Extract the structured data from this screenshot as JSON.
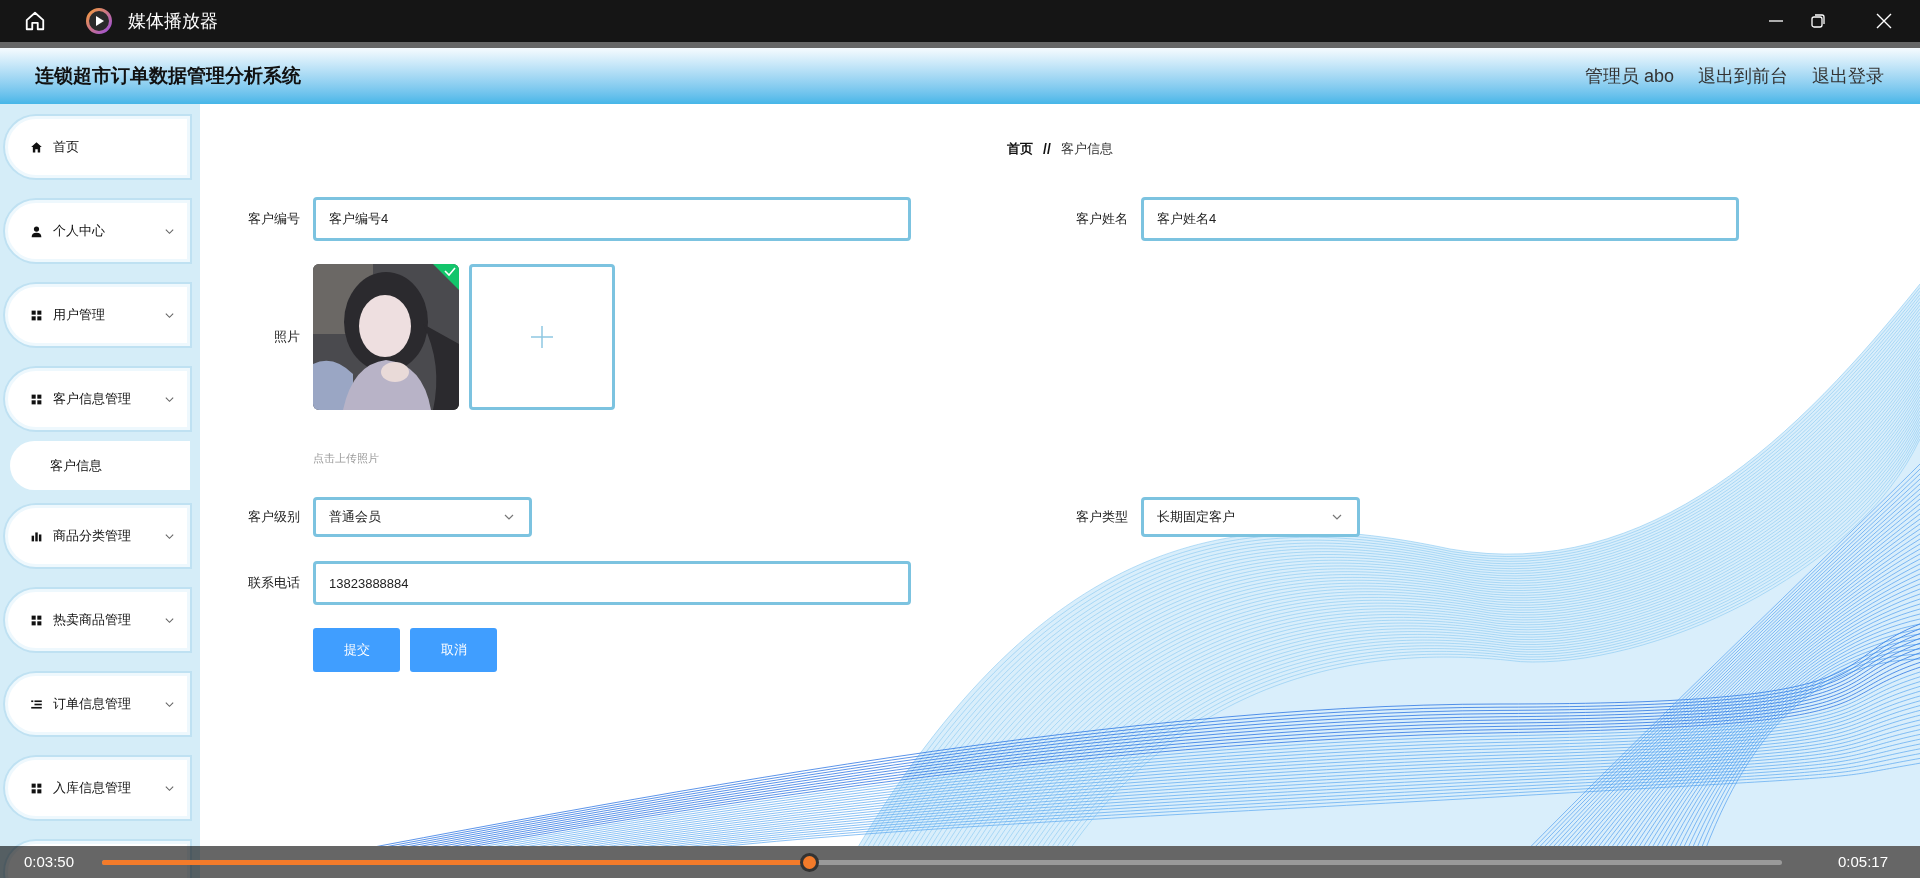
{
  "player": {
    "title": "媒体播放器",
    "elapsed": "0:03:50",
    "total": "0:05:17",
    "progress": {
      "level": 0.42
    }
  },
  "header": {
    "title": "连锁超市订单数据管理分析系统",
    "links": [
      "管理员 abo",
      "退出到前台",
      "退出登录"
    ]
  },
  "sidebar": {
    "items": [
      {
        "label": "首页",
        "kind": "link"
      },
      {
        "label": "个人中心",
        "kind": "menu"
      },
      {
        "label": "用户管理",
        "kind": "menu"
      },
      {
        "label": "客户信息管理",
        "kind": "menu",
        "children": [
          {
            "label": "客户信息"
          }
        ]
      },
      {
        "label": "商品分类管理",
        "kind": "menu"
      },
      {
        "label": "热卖商品管理",
        "kind": "menu"
      },
      {
        "label": "订单信息管理",
        "kind": "menu"
      },
      {
        "label": "入库信息管理",
        "kind": "menu"
      }
    ]
  },
  "breadcrumb": {
    "items": [
      "首页",
      "客户信息"
    ],
    "separator": "//"
  },
  "form": {
    "rows": [
      {
        "left": {
          "kind": "text",
          "label": "客户编号",
          "value": "客户编号4"
        },
        "right": {
          "kind": "text",
          "label": "客户姓名",
          "value": "客户姓名4"
        }
      },
      {
        "left": {
          "kind": "upload",
          "label": "照片",
          "hint": "点击上传照片"
        }
      },
      {
        "left": {
          "kind": "select",
          "label": "客户级别",
          "value": "普通会员"
        },
        "right": {
          "kind": "select",
          "label": "客户类型",
          "value": "长期固定客户"
        }
      },
      {
        "left": {
          "kind": "text",
          "label": "联系电话",
          "value": "13823888884"
        }
      }
    ],
    "buttons": [
      "提交",
      "取消"
    ]
  }
}
